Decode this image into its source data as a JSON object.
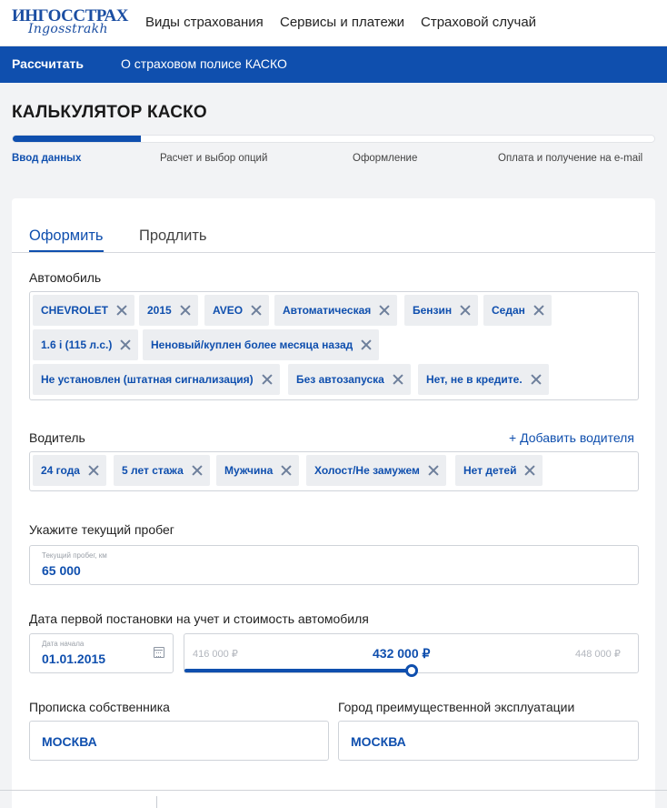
{
  "header": {
    "logo_main": "ИНГОССТРАХ",
    "logo_script": "Ingosstrakh",
    "nav": [
      "Виды страхования",
      "Сервисы и платежи",
      "Страховой случай"
    ]
  },
  "subnav": {
    "active": "Рассчитать",
    "link": "О страховом полисе КАСКО"
  },
  "page_title": "КАЛЬКУЛЯТОР КАСКО",
  "progress": {
    "fraction": 0.2
  },
  "steps": [
    "Ввод данных",
    "Расчет и выбор опций",
    "Оформление",
    "Оплата и получение на e-mail"
  ],
  "tabs": [
    "Оформить",
    "Продлить"
  ],
  "car": {
    "label": "Автомобиль",
    "chips": [
      "CHEVROLET",
      "2015",
      "AVEO",
      "Автоматическая",
      "Бензин",
      "Седан",
      "1.6 i (115 л.с.)",
      "Неновый/куплен более месяца назад",
      "Не установлен (штатная сигнализация)",
      "Без автозапуска",
      "Нет, не в кредите."
    ]
  },
  "driver": {
    "label": "Водитель",
    "add_label": "+ Добавить водителя",
    "chips": [
      "24 года",
      "5 лет стажа",
      "Мужчина",
      "Холост/Не замужем",
      "Нет детей"
    ]
  },
  "mileage": {
    "label": "Укажите текущий пробег",
    "field_caption": "Текущий пробег, км",
    "value": "65 000"
  },
  "registration": {
    "label": "Дата первой постановки на учет и стоимость автомобиля",
    "date_caption": "Дата начала",
    "date_value": "01.01.2015",
    "price_min": "416 000 ₽",
    "price_max": "448 000 ₽",
    "price_value": "432 000 ₽",
    "slider_fraction": 0.5
  },
  "owner": {
    "label": "Прописка собственника",
    "value": "МОСКВА"
  },
  "city": {
    "label": "Город преимущественной эксплуатации",
    "value": "МОСКВА"
  },
  "colors": {
    "brand_blue": "#0f4fae",
    "chip_bg": "#eceef1"
  },
  "icons": {
    "chip_remove": "close-icon",
    "date": "calendar-icon"
  }
}
